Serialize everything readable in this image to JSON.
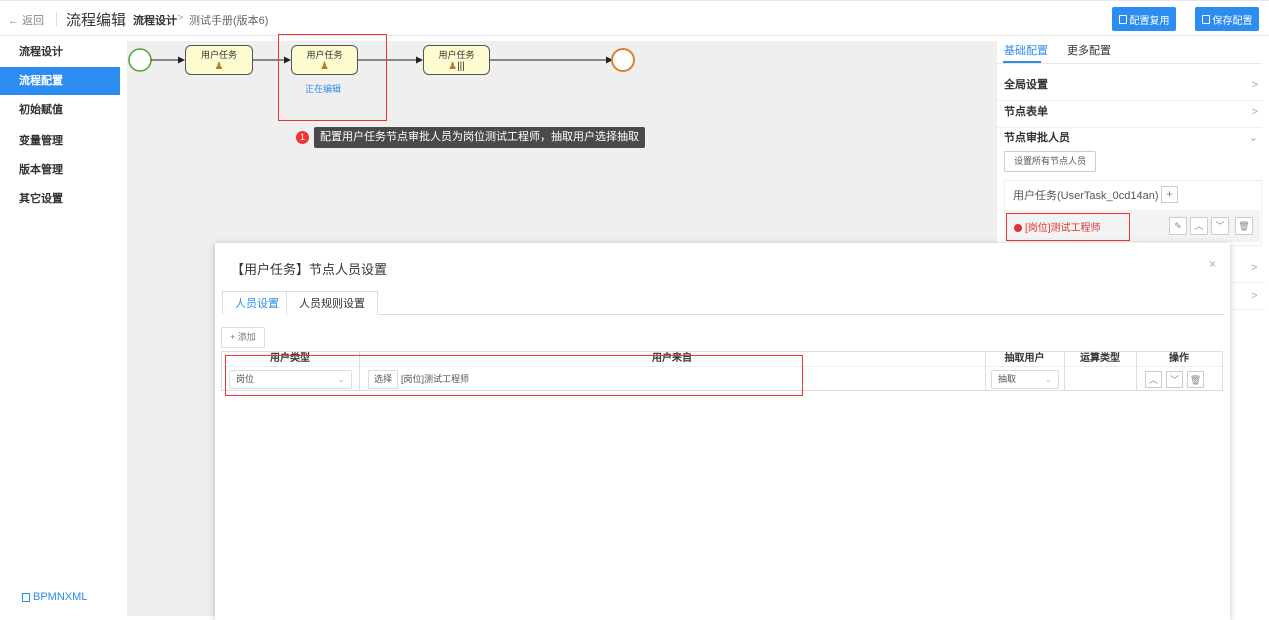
{
  "header": {
    "back_label": "← 返回",
    "app_title": "流程编辑",
    "breadcrumb_root": "流程设计",
    "breadcrumb_sep": ">",
    "breadcrumb_current": "测试手册(版本6)",
    "reuse_button": "配置复用",
    "save_button": "保存配置"
  },
  "sidebar": {
    "items": [
      {
        "label": "流程设计"
      },
      {
        "label": "流程配置"
      },
      {
        "label": "初始赋值"
      },
      {
        "label": "变量管理"
      },
      {
        "label": "版本管理"
      },
      {
        "label": "其它设置"
      }
    ],
    "bpmn_link": "BPMNXML"
  },
  "canvas": {
    "tasks": [
      {
        "label": "用户任务"
      },
      {
        "label": "用户任务"
      },
      {
        "label": "用户任务"
      }
    ],
    "editing_label": "正在编辑",
    "tooltip_badge": "1",
    "tooltip_text": "配置用户任务节点审批人员为岗位测试工程师，抽取用户选择抽取"
  },
  "right_panel": {
    "tabs": [
      {
        "label": "基础配置"
      },
      {
        "label": "更多配置"
      }
    ],
    "sections": {
      "global": "全局设置",
      "form": "节点表单",
      "approvers": "节点审批人员"
    },
    "set_all_button": "设置所有节点人员",
    "node_title": "用户任务(UserTask_0cd14an)",
    "node_plus": "+",
    "node_assignee": "[岗位]测试工程师"
  },
  "modal": {
    "title": "【用户任务】节点人员设置",
    "close": "×",
    "tabs": [
      {
        "label": "人员设置"
      },
      {
        "label": "人员规则设置"
      }
    ],
    "add_button": "+ 添加",
    "columns": {
      "user_type": "用户类型",
      "user_source": "用户来自",
      "pick_user": "抽取用户",
      "op_type": "运算类型",
      "actions": "操作"
    },
    "row": {
      "user_type": "岗位",
      "choose_button": "选择",
      "user_source": "[岗位]测试工程师",
      "pick_user": "抽取"
    }
  },
  "colors": {
    "accent": "#2d8cf0",
    "error": "#e33333",
    "task_fill": "#fdfcd0",
    "start_event": "#5a9a3a",
    "end_event": "#d9822b"
  }
}
